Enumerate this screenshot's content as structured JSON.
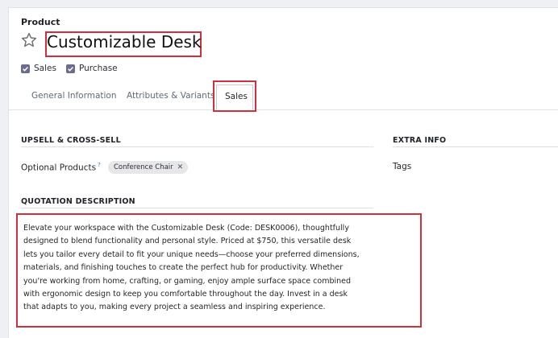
{
  "product": {
    "label": "Product",
    "name": "Customizable Desk",
    "sales_label": "Sales",
    "purchase_label": "Purchase"
  },
  "tabs": [
    {
      "label": "General Information"
    },
    {
      "label": "Attributes & Variants"
    },
    {
      "label": "Sales",
      "active": true
    }
  ],
  "upsell": {
    "title": "UPSELL & CROSS-SELL",
    "optional_products_label": "Optional Products",
    "help_mark": "?",
    "tags": [
      "Conference Chair"
    ]
  },
  "extra_info": {
    "title": "EXTRA INFO",
    "tags_label": "Tags"
  },
  "quotation": {
    "title": "QUOTATION DESCRIPTION",
    "text": "Elevate your workspace with the Customizable Desk (Code: DESK0006), thoughtfully designed to blend functionality and personal style. Priced at $750, this versatile desk lets you tailor every detail to fit your unique needs—choose your preferred dimensions, materials, and finishing touches to create the perfect hub for productivity. Whether you're working from home, crafting, or gaming, enjoy ample surface space combined with ergonomic design to keep you comfortable throughout the day. Invest in a desk that adapts to you, making every project a seamless and inspiring experience."
  },
  "colors": {
    "highlight": "#d0303c",
    "checkbox": "#6c6c8f"
  },
  "icons": [
    "star-icon",
    "check-icon",
    "remove-tag-icon"
  ]
}
